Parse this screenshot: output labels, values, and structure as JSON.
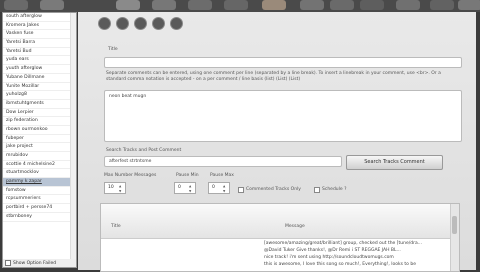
{
  "sidebar": {
    "items": [
      "south afterglow",
      "Kromera Jakes",
      "Vasken fuse",
      "Yaretsi Barra",
      "Yaretsi Bud",
      "yuda ears",
      "yuuth afterglow",
      "Yubane Dillmane",
      "Yunite Mozillar",
      "yuholzg8",
      "ibmstuhtgments",
      "Dow Lerpier",
      "zip federation",
      "rbown ourmonkoo",
      "fubeper",
      "jake project",
      "mrubidov",
      "scottie 4 michelsine2",
      "stuartmocklov",
      "pammy k zapar",
      "fomstow",
      "rcpsummeriers",
      "portbird + persse74",
      "stbrnboney"
    ],
    "selected_index": 19,
    "show_option_label": "Show Option Failed"
  },
  "form": {
    "title_label": "Title",
    "title_value": "",
    "help_text": "Separate comments can be entered, using one comment per line (separated by a line break). To insert a linebreak in your comment, use <br>. Or a standard comma notation is accepted - on a per comment / line basis (list) (List) (List)",
    "comment_value": "neon beat mugn",
    "search_label": "Search Tracks and Post Comment",
    "search_value": "afterfest strtntsme",
    "search_button": "Search Tracks Comment",
    "max_label": "Max Number Messages",
    "max_value": "10",
    "pause_min_label": "Pause Min",
    "pause_min_value": "0",
    "pause_max_label": "Pause Max",
    "pause_max_value": "0",
    "commented_label": "Commented Tracks Only",
    "schedule_label": "Schedule ?"
  },
  "table": {
    "col_title": "Title",
    "col_message": "Message",
    "rows": [
      "[awesome/amazing/great/brilliant] group, checked out the [tune/dra...",
      "@David Tuker Give thanks!, @Dr Remi i ST REGGAE JAH BL...",
      "nice track! i'm sent using http://soundcloudtwomugs.com",
      "this is awesome, I love this song so much!, Everything!, looks to be"
    ]
  }
}
